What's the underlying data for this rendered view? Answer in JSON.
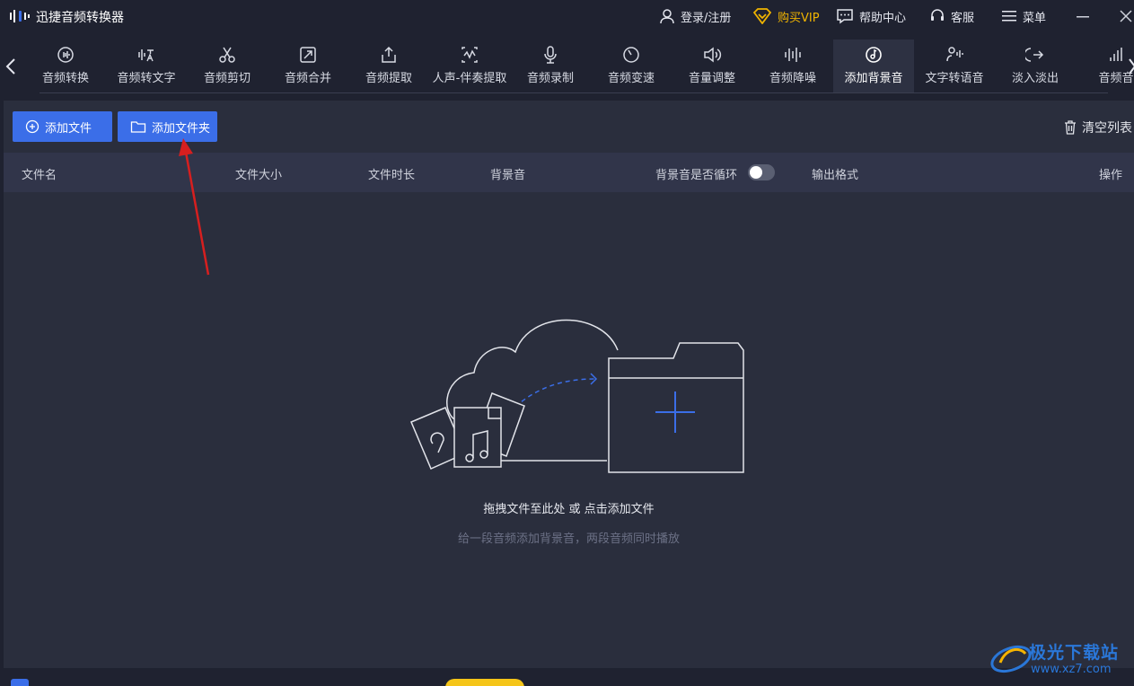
{
  "window": {
    "app_title": "迅捷音频转换器",
    "login_label": "登录/注册",
    "vip_label": "购买VIP",
    "help_label": "帮助中心",
    "service_label": "客服",
    "menu_label": "菜单"
  },
  "tools": [
    {
      "label": "音频转换",
      "icon": "audio-convert-icon"
    },
    {
      "label": "音频转文字",
      "icon": "speech-to-text-icon"
    },
    {
      "label": "音频剪切",
      "icon": "scissors-icon"
    },
    {
      "label": "音频合并",
      "icon": "merge-icon"
    },
    {
      "label": "音频提取",
      "icon": "extract-icon"
    },
    {
      "label": "人声-伴奏提取",
      "icon": "vocal-separate-icon"
    },
    {
      "label": "音频录制",
      "icon": "microphone-icon"
    },
    {
      "label": "音频变速",
      "icon": "speed-icon"
    },
    {
      "label": "音量调整",
      "icon": "volume-icon"
    },
    {
      "label": "音频降噪",
      "icon": "denoise-icon"
    },
    {
      "label": "添加背景音",
      "icon": "music-disc-icon",
      "active": true
    },
    {
      "label": "文字转语音",
      "icon": "text-to-speech-icon"
    },
    {
      "label": "淡入淡出",
      "icon": "fade-icon"
    },
    {
      "label": "音频音",
      "icon": "bars-icon"
    }
  ],
  "actions": {
    "add_file": "添加文件",
    "add_folder": "添加文件夹",
    "clear_list": "清空列表"
  },
  "table": {
    "columns": {
      "name": "文件名",
      "size": "文件大小",
      "duration": "文件时长",
      "bg": "背景音",
      "loop": "背景音是否循环",
      "format": "输出格式",
      "op": "操作"
    },
    "loop_enabled": false
  },
  "empty": {
    "hint": "拖拽文件至此处 或 点击添加文件",
    "subhint": "给一段音频添加背景音，两段音频同时播放"
  },
  "watermark": {
    "name": "极光下载站",
    "url": "www.xz7.com"
  },
  "colors": {
    "accent": "#3b6ee8",
    "vip": "#f0b400",
    "background": "#1f2230",
    "panel": "#2a2e3d",
    "annotation_arrow": "#d61f1f"
  }
}
